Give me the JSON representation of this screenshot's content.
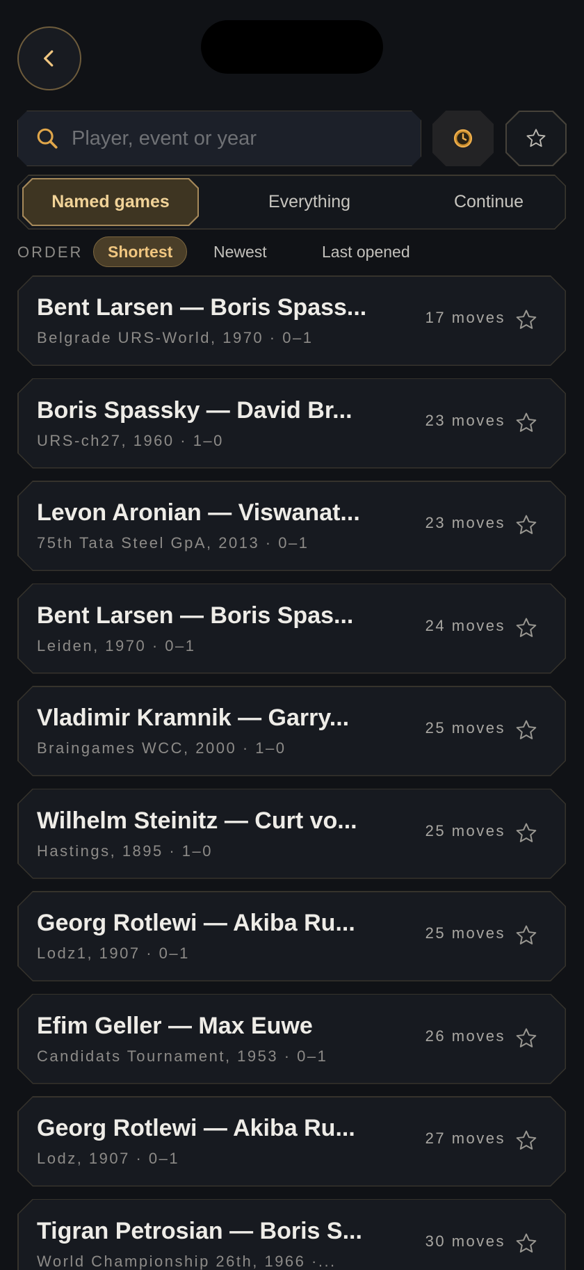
{
  "search": {
    "placeholder": "Player, event or year"
  },
  "tabs": [
    {
      "label": "Named games",
      "active": true
    },
    {
      "label": "Everything",
      "active": false
    },
    {
      "label": "Continue",
      "active": false
    }
  ],
  "order": {
    "label": "ORDER",
    "options": [
      {
        "label": "Shortest",
        "active": true
      },
      {
        "label": "Newest",
        "active": false
      },
      {
        "label": "Last opened",
        "active": false
      }
    ]
  },
  "games": [
    {
      "title": "Bent Larsen — Boris Spass...",
      "meta": "Belgrade URS-World, 1970 · 0–1",
      "moves": "17 moves"
    },
    {
      "title": "Boris Spassky — David Br...",
      "meta": "URS-ch27, 1960 · 1–0",
      "moves": "23 moves"
    },
    {
      "title": "Levon Aronian — Viswanat...",
      "meta": "75th Tata Steel GpA, 2013 · 0–1",
      "moves": "23 moves"
    },
    {
      "title": "Bent Larsen — Boris Spas...",
      "meta": "Leiden, 1970 · 0–1",
      "moves": "24 moves"
    },
    {
      "title": "Vladimir Kramnik — Garry...",
      "meta": "Braingames WCC, 2000 · 1–0",
      "moves": "25 moves"
    },
    {
      "title": "Wilhelm Steinitz — Curt vo...",
      "meta": "Hastings, 1895 · 1–0",
      "moves": "25 moves"
    },
    {
      "title": "Georg Rotlewi — Akiba Ru...",
      "meta": "Lodz1, 1907 · 0–1",
      "moves": "25 moves"
    },
    {
      "title": "Efim Geller — Max Euwe",
      "meta": "Candidats Tournament, 1953 · 0–1",
      "moves": "26 moves"
    },
    {
      "title": "Georg Rotlewi — Akiba Ru...",
      "meta": "Lodz, 1907 · 0–1",
      "moves": "27 moves"
    },
    {
      "title": "Tigran Petrosian — Boris S...",
      "meta": "World Championship 26th, 1966 ·...",
      "moves": "30 moves"
    }
  ],
  "colors": {
    "accent": "#f0c680",
    "background": "#101216",
    "card": "#171a20"
  },
  "icons": {
    "back": "chevron-left-icon",
    "search": "search-icon",
    "history": "clock-icon",
    "favorite": "star-icon"
  }
}
